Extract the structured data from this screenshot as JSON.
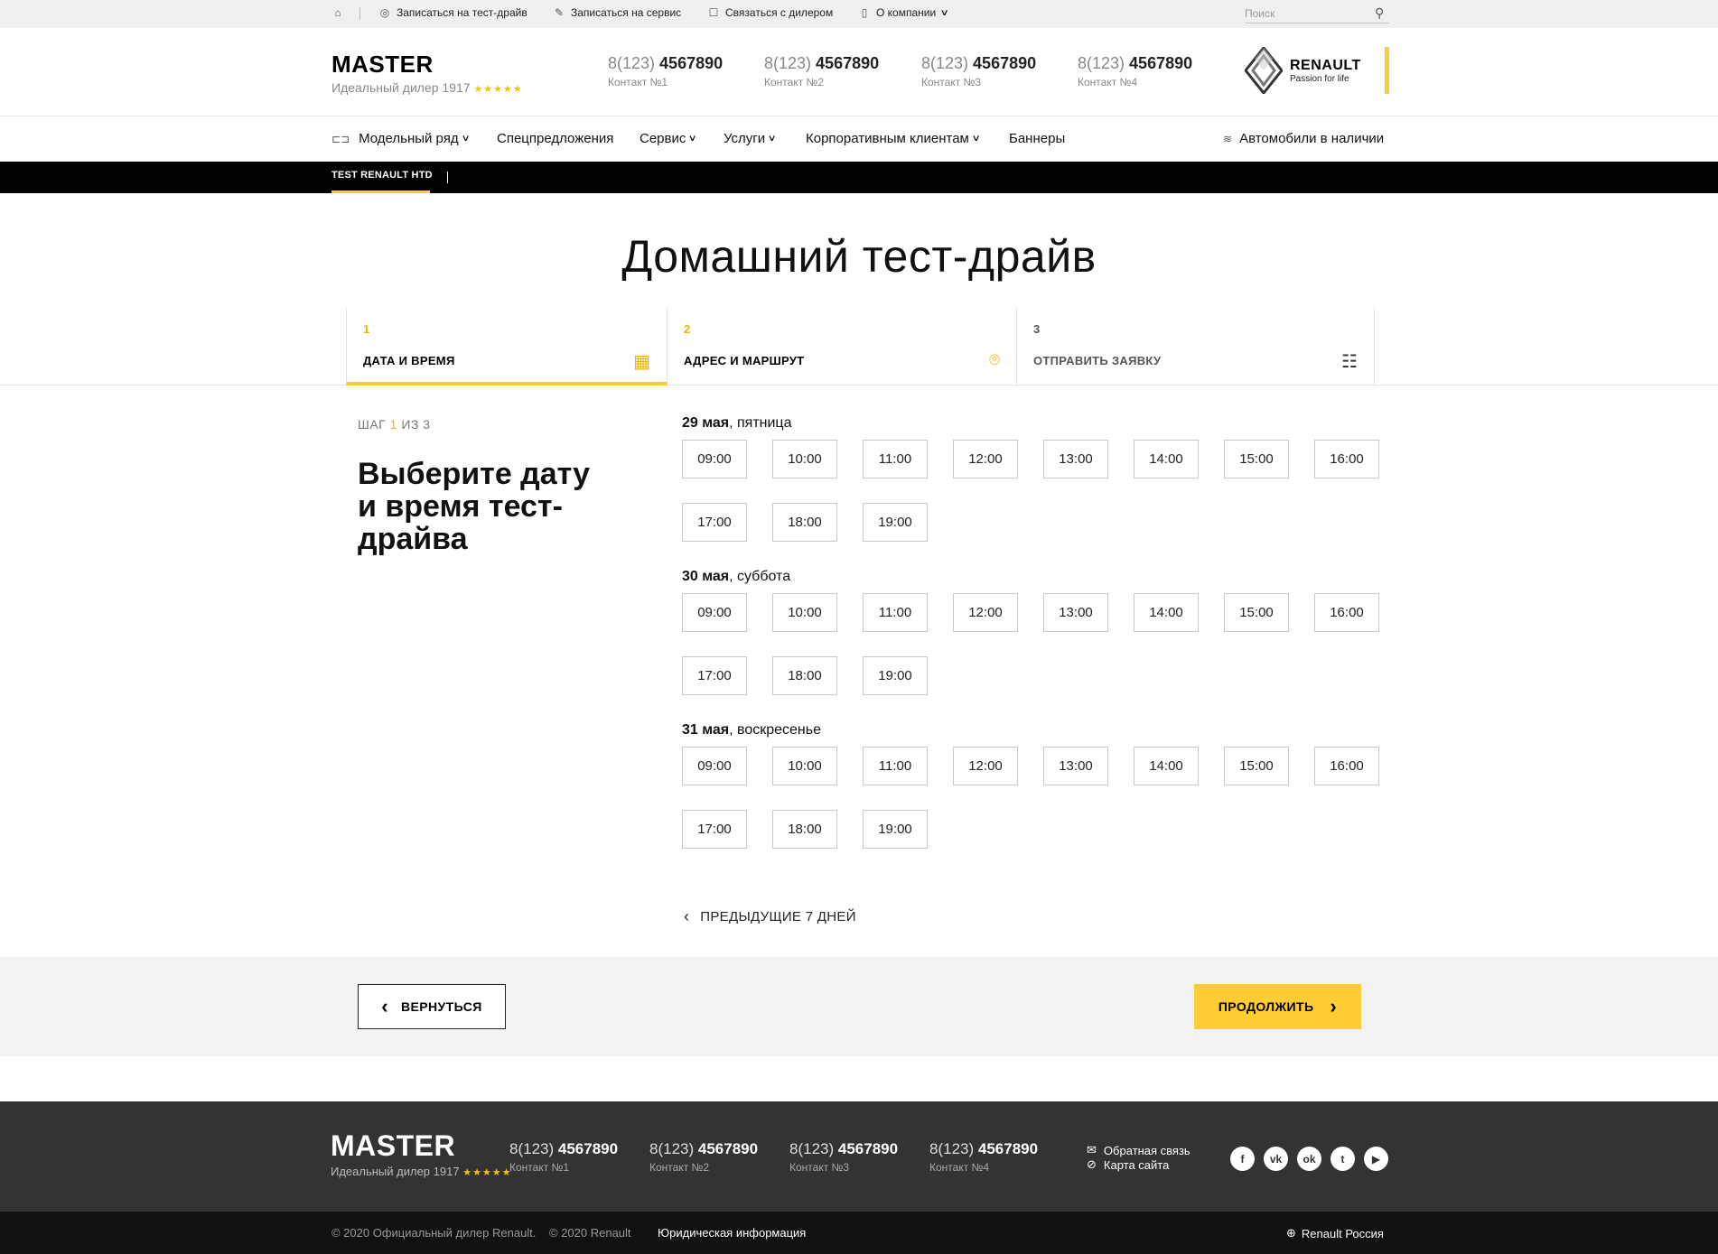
{
  "topbar": {
    "items": [
      {
        "label": "Записаться на тест-драйв",
        "icon": "steering-wheel-icon"
      },
      {
        "label": "Записаться на сервис",
        "icon": "wrench-icon"
      },
      {
        "label": "Связаться с дилером",
        "icon": "phone-icon"
      },
      {
        "label": "О компании",
        "icon": "building-icon"
      }
    ],
    "search_placeholder": "Поиск"
  },
  "header": {
    "brand": "MASTER",
    "brand_sub": "Идеальный дилер 1917",
    "stars": "★★★★★",
    "contacts": [
      {
        "pre": "8(123)",
        "main": "4567890",
        "label": "Контакт №1"
      },
      {
        "pre": "8(123)",
        "main": "4567890",
        "label": "Контакт №2"
      },
      {
        "pre": "8(123)",
        "main": "4567890",
        "label": "Контакт №3"
      },
      {
        "pre": "8(123)",
        "main": "4567890",
        "label": "Контакт №4"
      }
    ],
    "logo_word": "RENAULT",
    "logo_tag": "Passion for life"
  },
  "nav": {
    "items": [
      "Модельный ряд",
      "Спецпредложения",
      "Сервис",
      "Услуги",
      "Корпоративным клиентам",
      "Баннеры"
    ],
    "right": "Автомобили в наличии"
  },
  "strip": {
    "tab": "TEST RENAULT HTD"
  },
  "page": {
    "title": "Домашний тест-драйв"
  },
  "steps": [
    {
      "n": "1",
      "title": "ДАТА И ВРЕМЯ"
    },
    {
      "n": "2",
      "title": "АДРЕС И МАРШРУТ"
    },
    {
      "n": "3",
      "title": "ОТПРАВИТЬ ЗАЯВКУ"
    }
  ],
  "stepcount": {
    "word": "ШАГ",
    "current": "1",
    "of": "ИЗ 3"
  },
  "choose": "Выберите дату и время тест-драйва",
  "days": [
    {
      "date": "29 мая",
      "weekday": "пятница",
      "slots": [
        "09:00",
        "10:00",
        "11:00",
        "12:00",
        "13:00",
        "14:00",
        "15:00",
        "16:00",
        "17:00",
        "18:00",
        "19:00"
      ]
    },
    {
      "date": "30 мая",
      "weekday": "суббота",
      "slots": [
        "09:00",
        "10:00",
        "11:00",
        "12:00",
        "13:00",
        "14:00",
        "15:00",
        "16:00",
        "17:00",
        "18:00",
        "19:00"
      ]
    },
    {
      "date": "31 мая",
      "weekday": "воскресенье",
      "slots": [
        "09:00",
        "10:00",
        "11:00",
        "12:00",
        "13:00",
        "14:00",
        "15:00",
        "16:00",
        "17:00",
        "18:00",
        "19:00"
      ]
    }
  ],
  "prev7": "ПРЕДЫДУЩИЕ 7 ДНЕЙ",
  "actions": {
    "back": "ВЕРНУТЬСЯ",
    "next": "ПРОДОЛЖИТЬ"
  },
  "footer": {
    "brand": "MASTER",
    "brand_sub": "Идеальный дилер 1917",
    "stars": "★★★★★",
    "contacts": [
      {
        "pre": "8(123)",
        "main": "4567890",
        "label": "Контакт №1"
      },
      {
        "pre": "8(123)",
        "main": "4567890",
        "label": "Контакт №2"
      },
      {
        "pre": "8(123)",
        "main": "4567890",
        "label": "Контакт №3"
      },
      {
        "pre": "8(123)",
        "main": "4567890",
        "label": "Контакт №4"
      }
    ],
    "links": [
      "Обратная связь",
      "Карта сайта"
    ],
    "social": [
      {
        "name": "facebook-icon",
        "glyph": "f"
      },
      {
        "name": "vk-icon",
        "glyph": "vk"
      },
      {
        "name": "odnoklassniki-icon",
        "glyph": "ok"
      },
      {
        "name": "twitter-icon",
        "glyph": "t"
      },
      {
        "name": "youtube-icon",
        "glyph": "▶"
      }
    ],
    "copyright1": "© 2020 Официальный дилер Renault.",
    "copyright2": "© 2020 Renault",
    "legal": "Юридическая информация",
    "region": "Renault Россия"
  },
  "colors": {
    "accent": "#ffcc33",
    "dark": "#333333",
    "black": "#000000"
  }
}
